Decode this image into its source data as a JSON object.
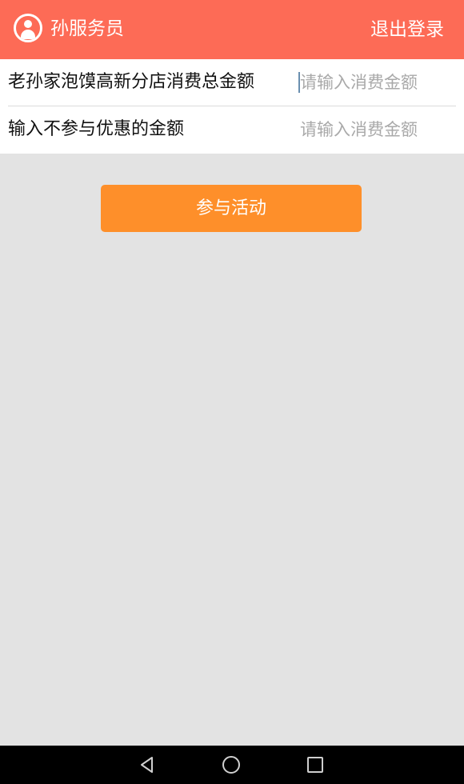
{
  "header": {
    "user_icon": "user-avatar-icon",
    "user_name": "孙服务员",
    "logout_label": "退出登录",
    "background_color": "#fd6b56"
  },
  "form": {
    "rows": [
      {
        "label": "老孙家泡馍高新分店消费总金额",
        "value": "",
        "placeholder": "请输入消费金额",
        "focused": true
      },
      {
        "label": "输入不参与优惠的金额",
        "value": "",
        "placeholder": "请输入消费金额",
        "focused": false
      }
    ]
  },
  "submit": {
    "label": "参与活动",
    "color": "#fe8f2a"
  },
  "navbar": {
    "back_icon": "back-triangle-icon",
    "home_icon": "home-circle-icon",
    "recent_icon": "recent-apps-square-icon"
  }
}
